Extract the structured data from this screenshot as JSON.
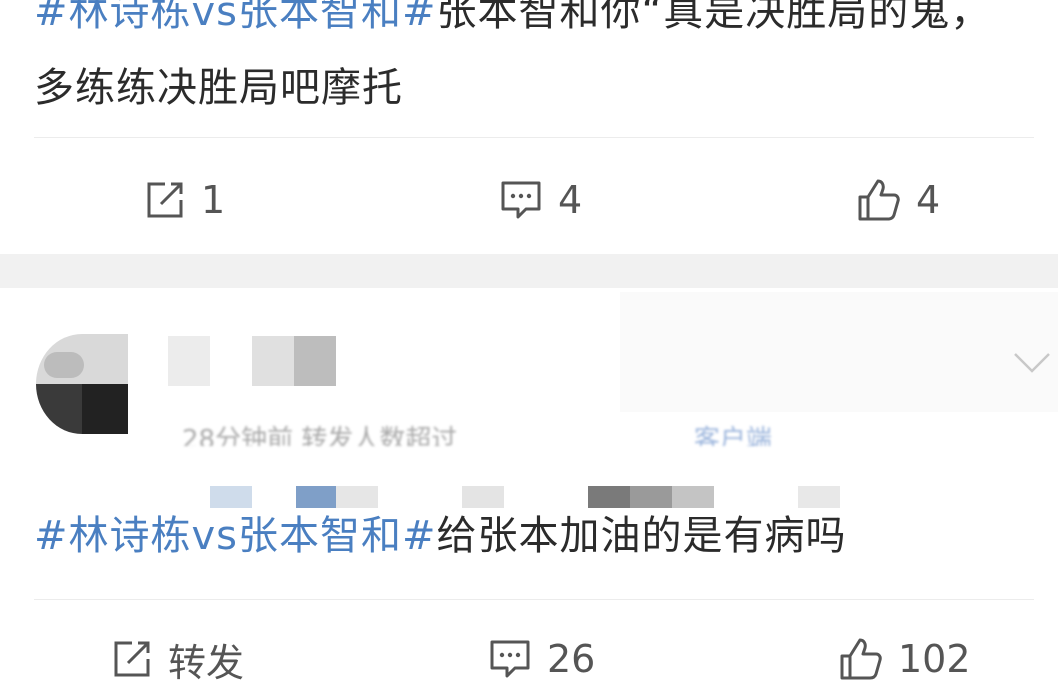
{
  "post1": {
    "hashtag": "#林诗栋vs张本智和#",
    "text": "张本智和你“真是决胜局的鬼，多练练决胜局吧摩托",
    "actions": {
      "repost": {
        "icon": "share-icon",
        "count": "1"
      },
      "comment": {
        "icon": "comment-icon",
        "count": "4"
      },
      "like": {
        "icon": "thumbs-up-icon",
        "count": "4"
      }
    }
  },
  "post2": {
    "meta": {
      "time": "28分钟前",
      "extra": "转发人数超过",
      "client": "客户端"
    },
    "hashtag": "#林诗栋vs张本智和#",
    "text": "给张本加油的是有病吗",
    "actions": {
      "repost": {
        "icon": "share-icon",
        "label": "转发"
      },
      "comment": {
        "icon": "comment-icon",
        "count": "26"
      },
      "like": {
        "icon": "thumbs-up-icon",
        "count": "102"
      }
    }
  },
  "colors": {
    "hashtag": "#4a7fc1",
    "text": "#2b2b2b",
    "icon": "#555555",
    "separator": "#f1f1f1"
  }
}
